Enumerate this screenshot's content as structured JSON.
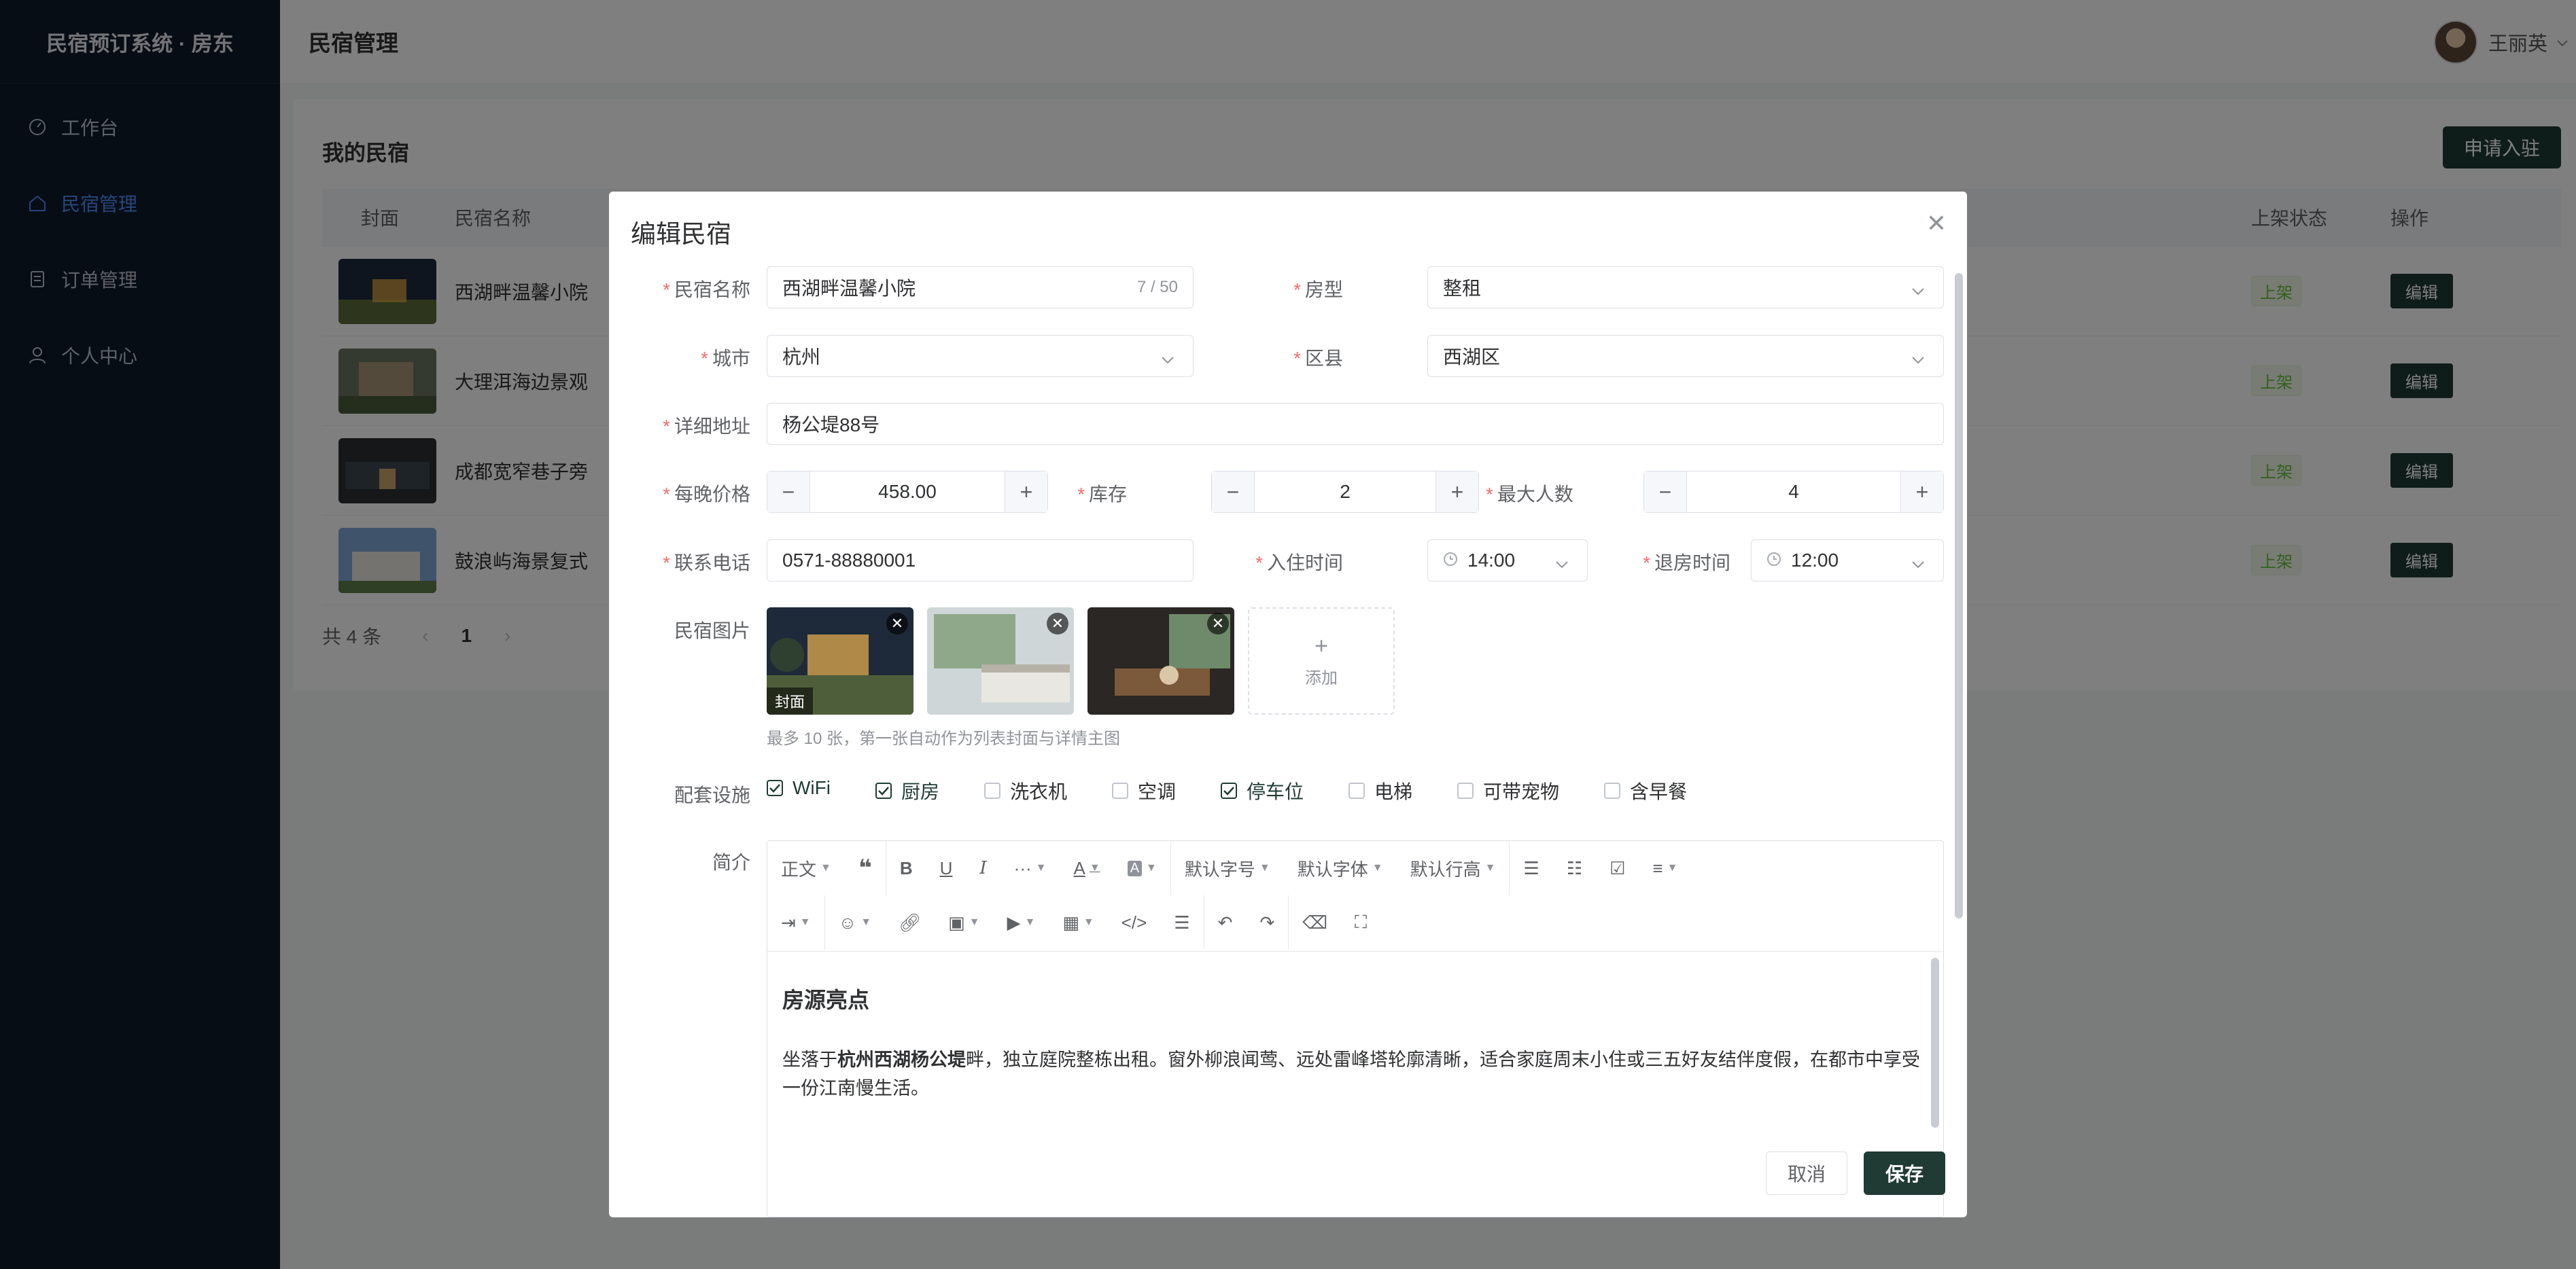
{
  "sidebar": {
    "brand": "民宿预订系统 · 房东",
    "items": [
      {
        "label": "工作台",
        "icon": "dashboard-icon"
      },
      {
        "label": "民宿管理",
        "icon": "home-icon",
        "active": true
      },
      {
        "label": "订单管理",
        "icon": "order-icon"
      },
      {
        "label": "个人中心",
        "icon": "user-icon"
      }
    ]
  },
  "header": {
    "title": "民宿管理",
    "user_name": "王丽英"
  },
  "list": {
    "title": "我的民宿",
    "apply_label": "申请入驻",
    "columns": {
      "cover": "封面",
      "name": "民宿名称",
      "status": "上架状态",
      "action": "操作"
    },
    "rows": [
      {
        "name": "西湖畔温馨小院",
        "status": "上架",
        "action": "编辑"
      },
      {
        "name": "大理洱海边景观",
        "status": "上架",
        "action": "编辑"
      },
      {
        "name": "成都宽窄巷子旁",
        "status": "上架",
        "action": "编辑"
      },
      {
        "name": "鼓浪屿海景复式",
        "status": "上架",
        "action": "编辑"
      }
    ],
    "total": "共 4 条",
    "page": "1"
  },
  "dialog": {
    "title": "编辑民宿",
    "name_label": "民宿名称",
    "name_value": "西湖畔温馨小院",
    "name_count": "7 / 50",
    "type_label": "房型",
    "type_value": "整租",
    "city_label": "城市",
    "city_value": "杭州",
    "district_label": "区县",
    "district_value": "西湖区",
    "address_label": "详细地址",
    "address_value": "杨公堤88号",
    "price_label": "每晚价格",
    "price_value": "458.00",
    "stock_label": "库存",
    "stock_value": "2",
    "max_label": "最大人数",
    "max_value": "4",
    "phone_label": "联系电话",
    "phone_value": "0571-88880001",
    "checkin_label": "入住时间",
    "checkin_value": "14:00",
    "checkout_label": "退房时间",
    "checkout_value": "12:00",
    "photos_label": "民宿图片",
    "cover_tag": "封面",
    "add_label": "添加",
    "photos_hint": "最多 10 张，第一张自动作为列表封面与详情主图",
    "facilities_label": "配套设施",
    "facilities": [
      {
        "label": "WiFi",
        "checked": true
      },
      {
        "label": "厨房",
        "checked": true
      },
      {
        "label": "洗衣机",
        "checked": false
      },
      {
        "label": "空调",
        "checked": false
      },
      {
        "label": "停车位",
        "checked": true
      },
      {
        "label": "电梯",
        "checked": false
      },
      {
        "label": "可带宠物",
        "checked": false
      },
      {
        "label": "含早餐",
        "checked": false
      }
    ],
    "intro_label": "简介",
    "toolbar": {
      "paragraph": "正文",
      "font_size": "默认字号",
      "font_family": "默认字体",
      "line_height": "默认行高"
    },
    "intro_heading": "房源亮点",
    "intro_pre": "坐落于",
    "intro_bold": "杭州西湖杨公堤",
    "intro_post": "畔，独立庭院整栋出租。窗外柳浪闻莺、远处雷峰塔轮廓清晰，适合家庭周末小住或三五好友结伴度假，在都市中享受一份江南慢生活。",
    "cancel_label": "取消",
    "save_label": "保存"
  }
}
